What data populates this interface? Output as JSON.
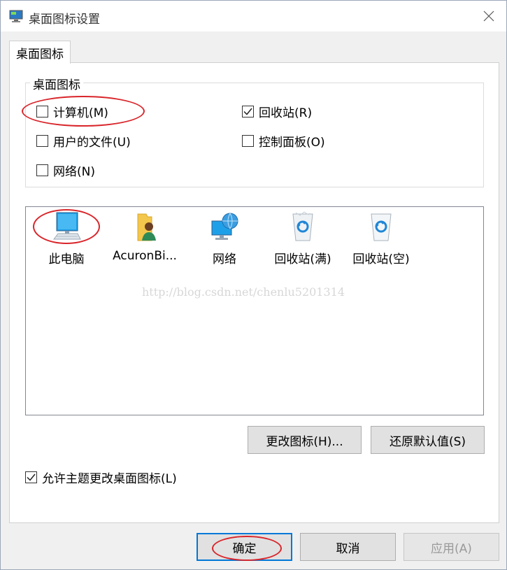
{
  "window": {
    "title": "桌面图标设置"
  },
  "tab": {
    "label": "桌面图标"
  },
  "group": {
    "label": "桌面图标",
    "checkboxes": [
      {
        "label": "计算机(M)",
        "checked": false
      },
      {
        "label": "回收站(R)",
        "checked": true
      },
      {
        "label": "用户的文件(U)",
        "checked": false
      },
      {
        "label": "控制面板(O)",
        "checked": false
      },
      {
        "label": "网络(N)",
        "checked": false
      }
    ]
  },
  "icon_list": {
    "items": [
      {
        "label": "此电脑",
        "icon": "computer-icon"
      },
      {
        "label": "AcuronBi...",
        "icon": "user-folder-icon"
      },
      {
        "label": "网络",
        "icon": "network-icon"
      },
      {
        "label": "回收站(满)",
        "icon": "recycle-bin-full-icon"
      },
      {
        "label": "回收站(空)",
        "icon": "recycle-bin-empty-icon"
      }
    ],
    "watermark": "http://blog.csdn.net/chenlu5201314"
  },
  "buttons": {
    "change_icon": "更改图标(H)...",
    "restore_default": "还原默认值(S)",
    "ok": "确定",
    "cancel": "取消",
    "apply": "应用(A)"
  },
  "allow_themes": {
    "label": "允许主题更改桌面图标(L)",
    "checked": true
  },
  "colors": {
    "annotation": "#d9252a",
    "accent": "#0078d7",
    "recycle_blue": "#1f86d6"
  }
}
